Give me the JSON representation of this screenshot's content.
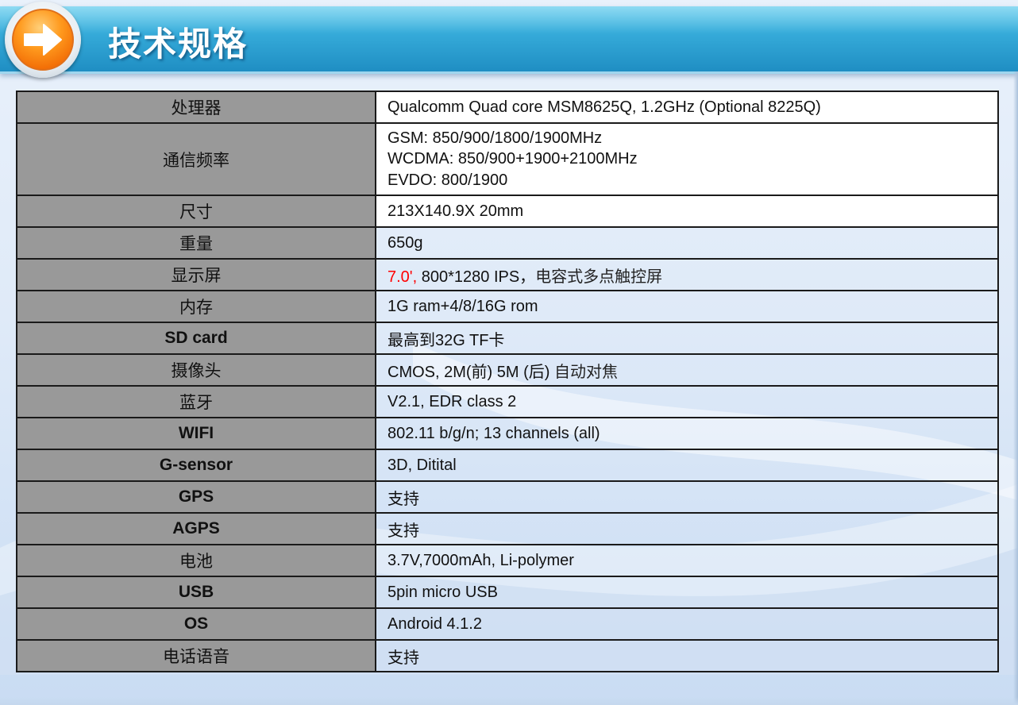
{
  "header": {
    "title": "技术规格"
  },
  "specs": [
    {
      "label": "处理器",
      "value": "Qualcomm Quad core MSM8625Q, 1.2GHz (Optional 8225Q)"
    },
    {
      "label": "通信频率",
      "lines": [
        "GSM: 850/900/1800/1900MHz",
        "WCDMA: 850/900+1900+2100MHz",
        "EVDO: 800/1900"
      ]
    },
    {
      "label": "尺寸",
      "value": "213X140.9X 20mm"
    },
    {
      "label": "重量",
      "value": "650g"
    },
    {
      "label": "显示屏",
      "value_red": "7.0',",
      "value_rest": " 800*1280 IPS，",
      "value_cjk": "电容式多点触控屏"
    },
    {
      "label": "内存",
      "value": "1G ram+4/8/16G rom"
    },
    {
      "label": "SD card",
      "value": "最高到32G TF卡"
    },
    {
      "label": "摄像头",
      "value": "CMOS, 2M(前) 5M (后) ",
      "value_cjk": "自动对焦"
    },
    {
      "label": "蓝牙",
      "value": "V2.1, EDR class 2"
    },
    {
      "label": "WIFI",
      "value": "802.11 b/g/n; 13 channels (all)"
    },
    {
      "label": "G-sensor",
      "value": "3D, Ditital"
    },
    {
      "label": "GPS",
      "value": "支持"
    },
    {
      "label": "AGPS",
      "value": "支持"
    },
    {
      "label": "电池",
      "value": "3.7V,7000mAh, Li-polymer"
    },
    {
      "label": "USB",
      "value": "5pin micro USB"
    },
    {
      "label": "OS",
      "value": "Android 4.1.2"
    },
    {
      "label": "电话语音",
      "value": "支持"
    }
  ],
  "colors": {
    "header_blue": "#34a9d8",
    "label_bg": "#999999",
    "accent_red": "#ff0000",
    "badge_orange": "#f26c05"
  },
  "icons": {
    "header_badge": "arrow-right-icon"
  }
}
